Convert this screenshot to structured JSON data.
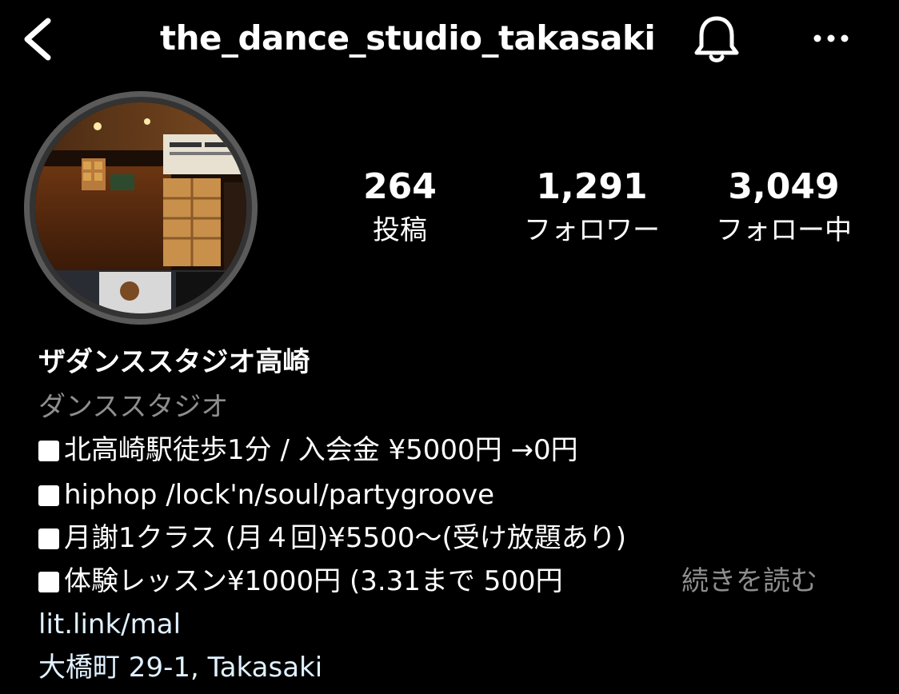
{
  "header": {
    "username": "the_dance_studio_takasaki",
    "back_icon": "chevron-left-icon",
    "notification_icon": "bell-icon",
    "more_icon": "more-horizontal-icon"
  },
  "profile": {
    "avatar_description": "studio-photo",
    "stats": [
      {
        "value": "264",
        "label": "投稿"
      },
      {
        "value": "1,291",
        "label": "フォロワー"
      },
      {
        "value": "3,049",
        "label": "フォロー中"
      }
    ]
  },
  "bio": {
    "display_name": "ザダンススタジオ高崎",
    "category": "ダンススタジオ",
    "lines": [
      "北高崎駅徒歩1分 / 入会金 ¥5000円 →0円",
      "hiphop /lock'n/soul/partygroove",
      "月謝1クラス (月４回)¥5500～(受け放題あり)",
      "体験レッスン¥1000円 (3.31まで 500円"
    ],
    "more_label": "続きを読む",
    "link": "lit.link/mal",
    "address": "大橋町 29-1, Takasaki"
  },
  "colors": {
    "background": "#000000",
    "text": "#ffffff",
    "secondary_text": "#8e8e8e",
    "link_text": "#e0f1ff"
  }
}
